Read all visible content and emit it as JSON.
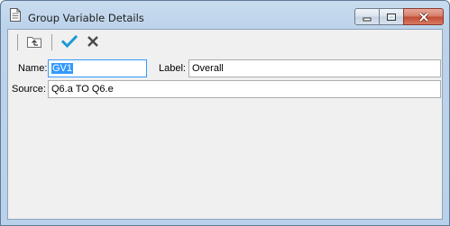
{
  "window": {
    "title": "Group Variable Details",
    "controls": {
      "minimize": "minimize-icon",
      "maximize": "maximize-icon",
      "close": "close-icon"
    }
  },
  "toolbar": {
    "buttons": [
      "parent-folder-icon",
      "checkmark-icon",
      "x-cross-icon"
    ]
  },
  "form": {
    "name_label": "Name:",
    "name_value": "GV1",
    "label_label": "Label:",
    "label_value": "Overall",
    "source_label": "Source:",
    "source_value": "Q6.a TO Q6.e"
  },
  "colors": {
    "accent_check": "#1c9ad6",
    "selection": "#3399ff",
    "close_button": "#c24a34"
  }
}
